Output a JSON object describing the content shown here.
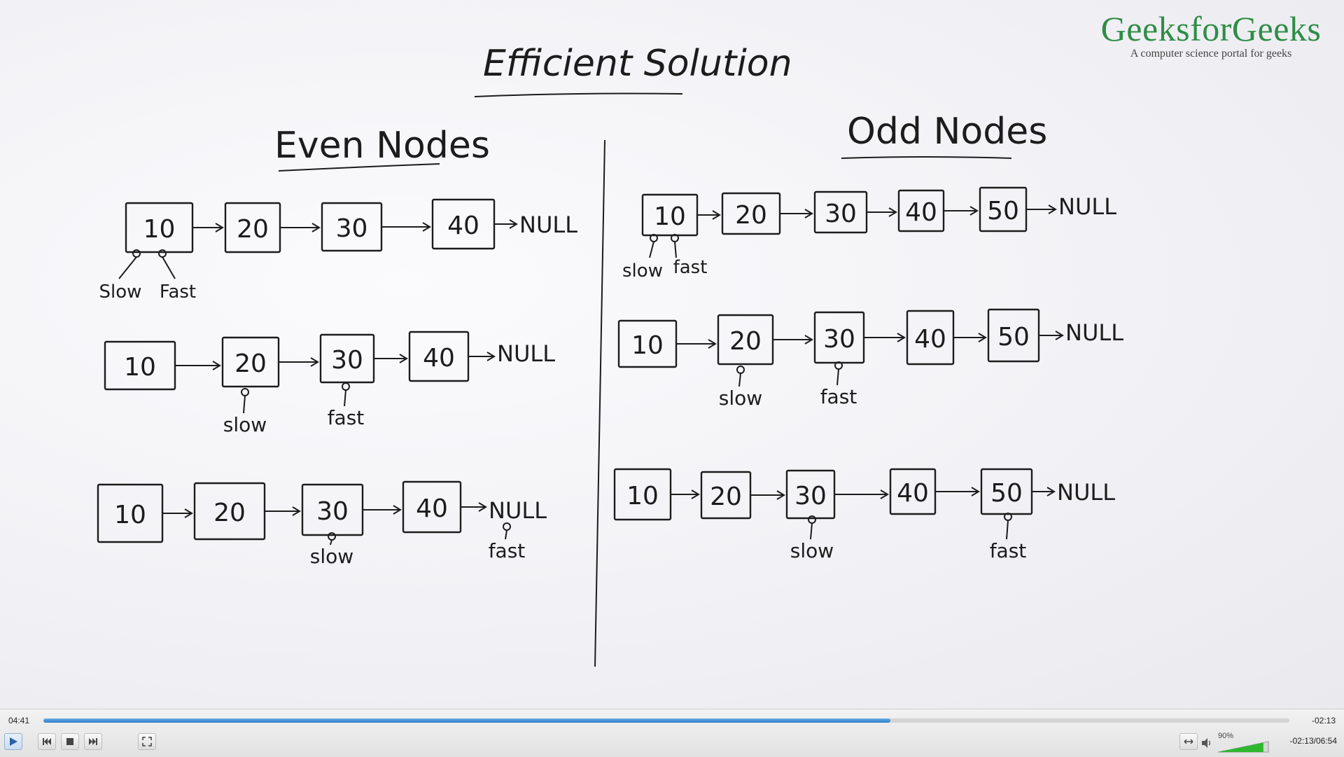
{
  "board": {
    "title": "Efficient Solution",
    "even_heading": "Even Nodes",
    "odd_heading": "Odd Nodes",
    "node_values": [
      "10",
      "20",
      "30",
      "40",
      "50"
    ],
    "null_label": "NULL",
    "slow_label": "slow",
    "fast_label": "fast",
    "slow_label_cap": "Slow",
    "fast_label_cap": "Fast"
  },
  "logo": {
    "brand": "GeeksforGeeks",
    "tagline": "A computer science portal for geeks"
  },
  "player": {
    "elapsed": "04:41",
    "remaining": "-02:13",
    "progress": 0.68,
    "volume_label": "90%",
    "volume": 0.9,
    "time_total": "-02:13/06:54",
    "icons": {
      "play": "play-icon",
      "previous": "skip-previous-icon",
      "stop": "stop-icon",
      "next": "skip-next-icon",
      "fullscreen": "fullscreen-icon",
      "aspect": "aspect-ratio-icon",
      "speaker": "speaker-icon"
    },
    "accent": "#2f7cc8",
    "volume_color": "#2eb82e"
  }
}
